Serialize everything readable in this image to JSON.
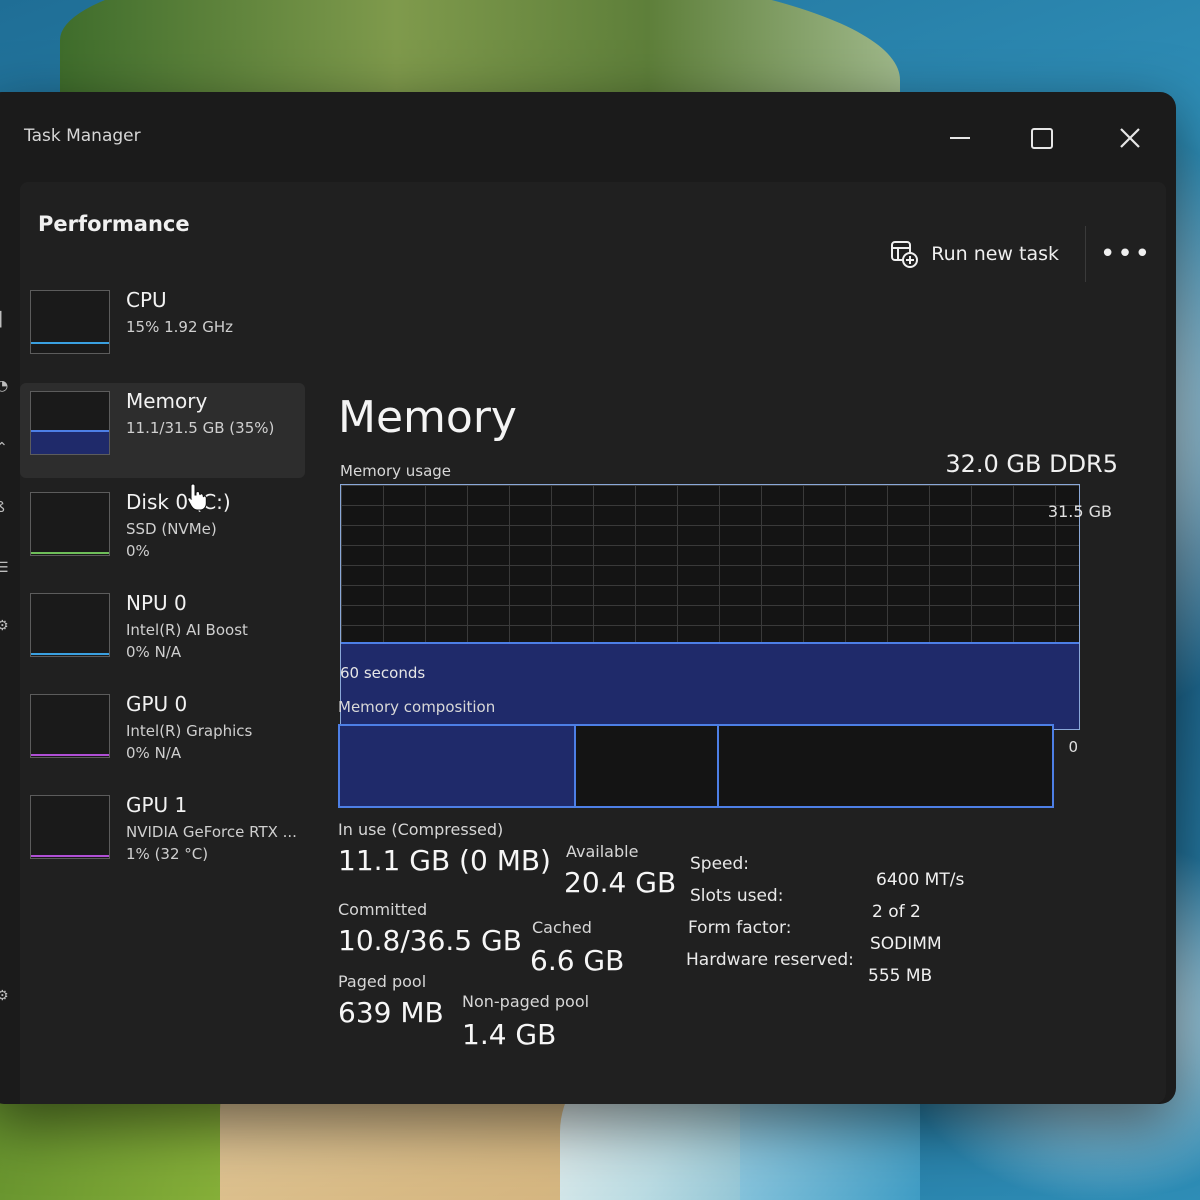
{
  "window": {
    "title": "Task Manager"
  },
  "page": {
    "title": "Performance"
  },
  "command_bar": {
    "run_new_task_label": "Run new task",
    "more_label": "•••"
  },
  "devices": [
    {
      "name": "CPU",
      "line1": "15%  1.92 GHz",
      "line2": "",
      "accent": "#3aa0e0",
      "utilization_percent": 15
    },
    {
      "name": "Memory",
      "line1": "11.1/31.5 GB (35%)",
      "line2": "",
      "accent": "#4d7fe6",
      "utilization_percent": 35
    },
    {
      "name": "Disk 0 (C:)",
      "line1": "SSD (NVMe)",
      "line2": "0%",
      "accent": "#6fbf5a",
      "utilization_percent": 0
    },
    {
      "name": "NPU 0",
      "line1": "Intel(R) AI Boost",
      "line2": "0%  N/A",
      "accent": "#3aa0e0",
      "utilization_percent": 0
    },
    {
      "name": "GPU 0",
      "line1": "Intel(R) Graphics",
      "line2": "0%  N/A",
      "accent": "#b04fd6",
      "utilization_percent": 0
    },
    {
      "name": "GPU 1",
      "line1": "NVIDIA GeForce RTX ...",
      "line2": "1%  (32 °C)",
      "accent": "#b04fd6",
      "utilization_percent": 1
    }
  ],
  "memory": {
    "title": "Memory",
    "spec": "32.0 GB DDR5",
    "usage_label": "Memory usage",
    "usage_max": "31.5 GB",
    "usage_percent": 35,
    "time_label": "60 seconds",
    "composition_label": "Memory composition",
    "composition_zero": "0",
    "composition": [
      {
        "name": "in-use",
        "fraction": 0.33
      },
      {
        "name": "modified",
        "fraction": 0.2
      },
      {
        "name": "standby",
        "fraction": 0.47
      }
    ],
    "stats": {
      "in_use_label": "In use (Compressed)",
      "in_use_value": "11.1 GB (0 MB)",
      "available_label": "Available",
      "available_value": "20.4 GB",
      "committed_label": "Committed",
      "committed_value": "10.8/36.5 GB",
      "cached_label": "Cached",
      "cached_value": "6.6 GB",
      "paged_pool_label": "Paged pool",
      "paged_pool_value": "639 MB",
      "non_paged_pool_label": "Non-paged pool",
      "non_paged_pool_value": "1.4 GB"
    },
    "specs": {
      "speed_label": "Speed:",
      "speed_value": "6400 MT/s",
      "slots_label": "Slots used:",
      "slots_value": "2 of 2",
      "form_label": "Form factor:",
      "form_value": "SODIMM",
      "reserved_label": "Hardware reserved:",
      "reserved_value": "555 MB"
    }
  },
  "colors": {
    "accent_blue": "#4d7fe6",
    "graph_fill": "#1f2a6a",
    "window_bg": "#1b1b1b"
  }
}
